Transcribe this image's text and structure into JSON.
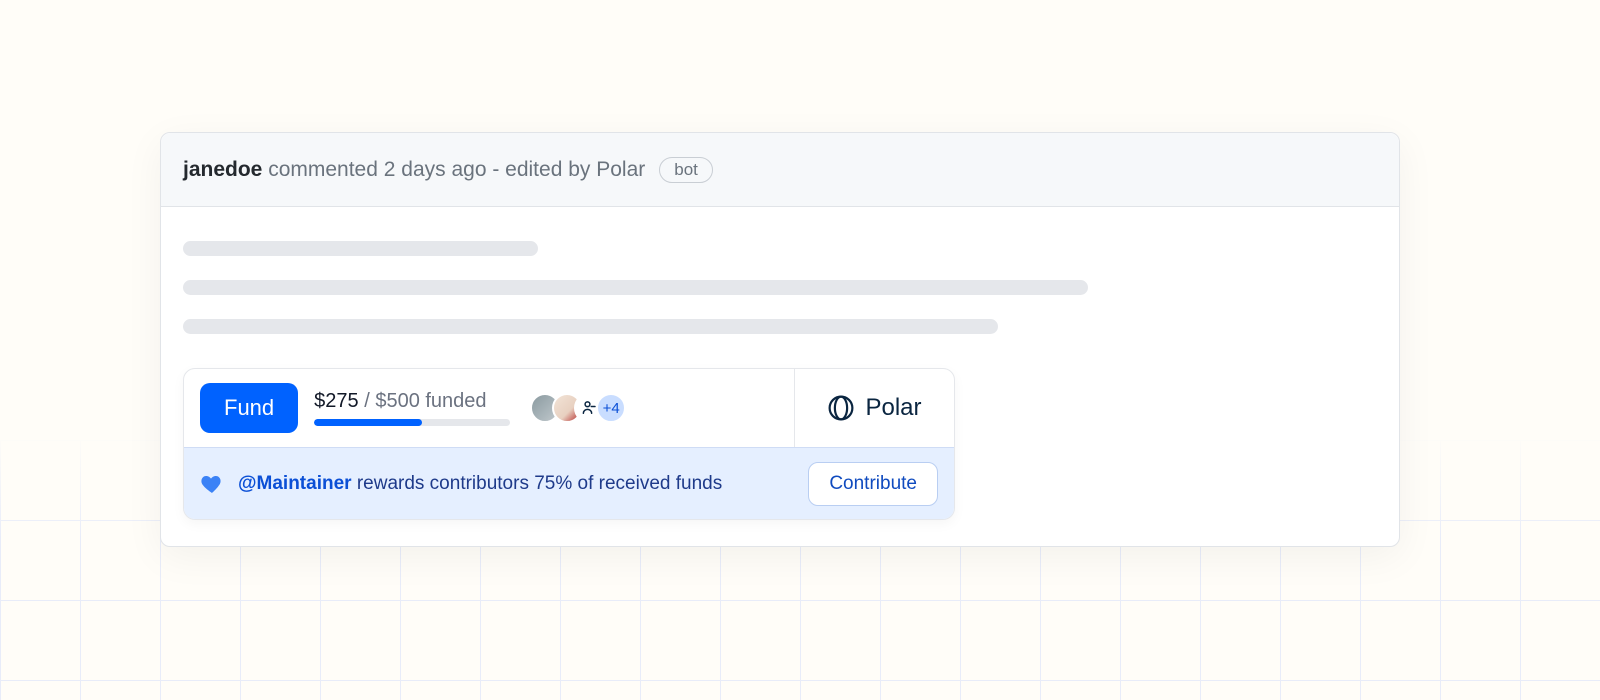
{
  "comment": {
    "author": "janedoe",
    "meta": "commented 2 days ago - edited by Polar",
    "bot_badge": "bot"
  },
  "widget": {
    "fund_button": "Fund",
    "raised": "$275",
    "goal_suffix": " / $500 funded",
    "progress_percent": 55,
    "more_backers": "+4",
    "brand": "Polar",
    "reward": {
      "maintainer": "@Maintainer",
      "text_suffix": " rewards contributors 75% of received funds"
    },
    "contribute_button": "Contribute"
  }
}
